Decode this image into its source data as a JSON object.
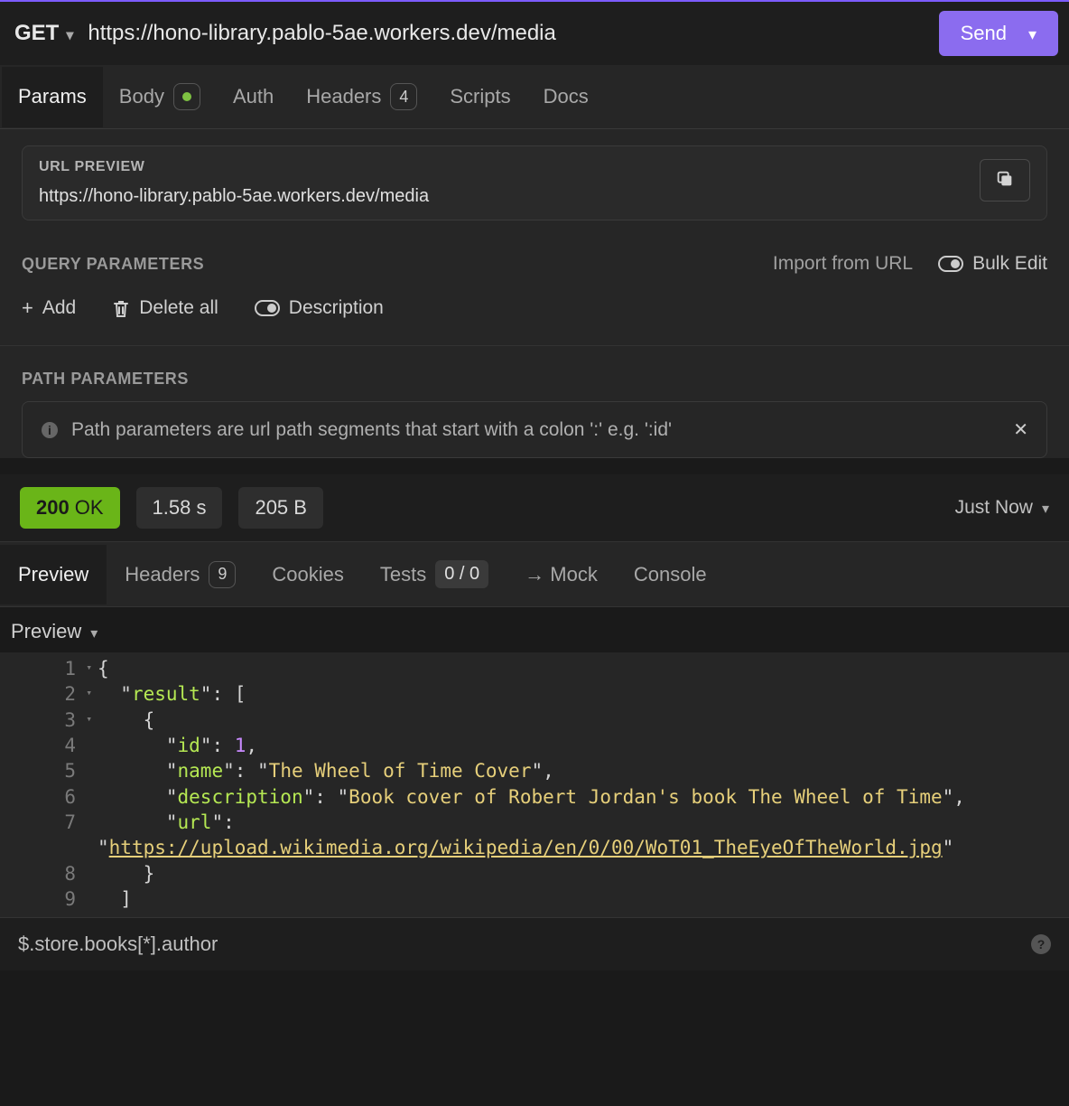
{
  "request": {
    "method": "GET",
    "url": "https://hono-library.pablo-5ae.workers.dev/media",
    "send_label": "Send"
  },
  "tabs": {
    "params": "Params",
    "body": "Body",
    "auth": "Auth",
    "headers": "Headers",
    "headers_count": "4",
    "scripts": "Scripts",
    "docs": "Docs"
  },
  "url_preview": {
    "label": "URL PREVIEW",
    "value": "https://hono-library.pablo-5ae.workers.dev/media"
  },
  "query_params": {
    "title": "QUERY PARAMETERS",
    "import_label": "Import from URL",
    "bulk_edit_label": "Bulk Edit",
    "add_label": "Add",
    "delete_all_label": "Delete all",
    "description_label": "Description"
  },
  "path_params": {
    "title": "PATH PARAMETERS",
    "info_text": "Path parameters are url path segments that start with a colon ':' e.g. ':id'"
  },
  "response": {
    "status_code": "200",
    "status_text": "OK",
    "time": "1.58 s",
    "size": "205 B",
    "timestamp": "Just Now"
  },
  "resp_tabs": {
    "preview": "Preview",
    "headers": "Headers",
    "headers_count": "9",
    "cookies": "Cookies",
    "tests": "Tests",
    "tests_count": "0 / 0",
    "mock": "→ Mock",
    "console": "Console"
  },
  "preview_dropdown": "Preview",
  "code": {
    "l1": "{",
    "l2a": "  \"",
    "l2b": "result",
    "l2c": "\": [",
    "l3": "    {",
    "l4a": "      \"",
    "l4b": "id",
    "l4c": "\": ",
    "l4d": "1",
    "l4e": ",",
    "l5a": "      \"",
    "l5b": "name",
    "l5c": "\": \"",
    "l5d": "The Wheel of Time Cover",
    "l5e": "\",",
    "l6a": "      \"",
    "l6b": "description",
    "l6c": "\": \"",
    "l6d": "Book cover of Robert Jordan's book The Wheel of Time",
    "l6e": "\",",
    "l7a": "      \"",
    "l7b": "url",
    "l7c": "\":",
    "l7wa": "\"",
    "l7wb": "https://upload.wikimedia.org/wikipedia/en/0/00/WoT01_TheEyeOfTheWorld.jpg",
    "l7wc": "\"",
    "l8": "    }",
    "l9": "  ]"
  },
  "gutter": {
    "l1": "1",
    "l2": "2",
    "l3": "3",
    "l4": "4",
    "l5": "5",
    "l6": "6",
    "l7": "7",
    "l8": "8",
    "l9": "9"
  },
  "footer": {
    "jsonpath": "$.store.books[*].author"
  }
}
